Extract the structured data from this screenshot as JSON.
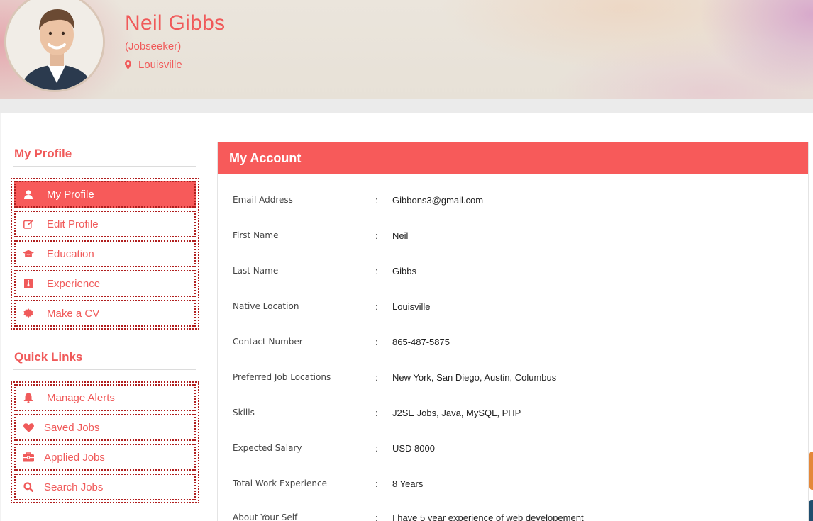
{
  "profile": {
    "name": "Neil Gibbs",
    "role": "(Jobseeker)",
    "location": "Louisville"
  },
  "sidebar": {
    "my_profile_heading": "My Profile",
    "profile_items": [
      {
        "label": "My Profile",
        "icon": "user-icon",
        "active": true
      },
      {
        "label": "Edit Profile",
        "icon": "edit-icon"
      },
      {
        "label": "Education",
        "icon": "graduation-cap-icon"
      },
      {
        "label": "Experience",
        "icon": "tie-icon"
      },
      {
        "label": "Make a CV",
        "icon": "certificate-icon"
      }
    ],
    "quick_links_heading": "Quick Links",
    "quick_links": [
      {
        "label": "Manage Alerts",
        "icon": "bell-icon"
      },
      {
        "label": "Saved Jobs",
        "icon": "heart-icon"
      },
      {
        "label": "Applied Jobs",
        "icon": "briefcase-icon"
      },
      {
        "label": "Search Jobs",
        "icon": "search-icon"
      }
    ]
  },
  "account": {
    "title": "My Account",
    "fields": [
      {
        "label": "Email Address",
        "value": "Gibbons3@gmail.com"
      },
      {
        "label": "First Name",
        "value": "Neil"
      },
      {
        "label": "Last Name",
        "value": "Gibbs"
      },
      {
        "label": "Native Location",
        "value": "Louisville"
      },
      {
        "label": "Contact Number",
        "value": "865-487-5875"
      },
      {
        "label": "Preferred Job Locations",
        "value": "New York, San Diego, Austin, Columbus"
      },
      {
        "label": "Skills",
        "value": "J2SE Jobs, Java, MySQL, PHP"
      },
      {
        "label": "Expected Salary",
        "value": "USD 8000"
      },
      {
        "label": "Total Work Experience",
        "value": "8 Years"
      },
      {
        "label": "About Your Self",
        "value": "I have 5 year experience of web developement"
      }
    ],
    "separator": ":"
  },
  "colors": {
    "accent": "#f75a5a",
    "accent_text": "#f05a5a",
    "dotted_border": "#b01e1e"
  }
}
